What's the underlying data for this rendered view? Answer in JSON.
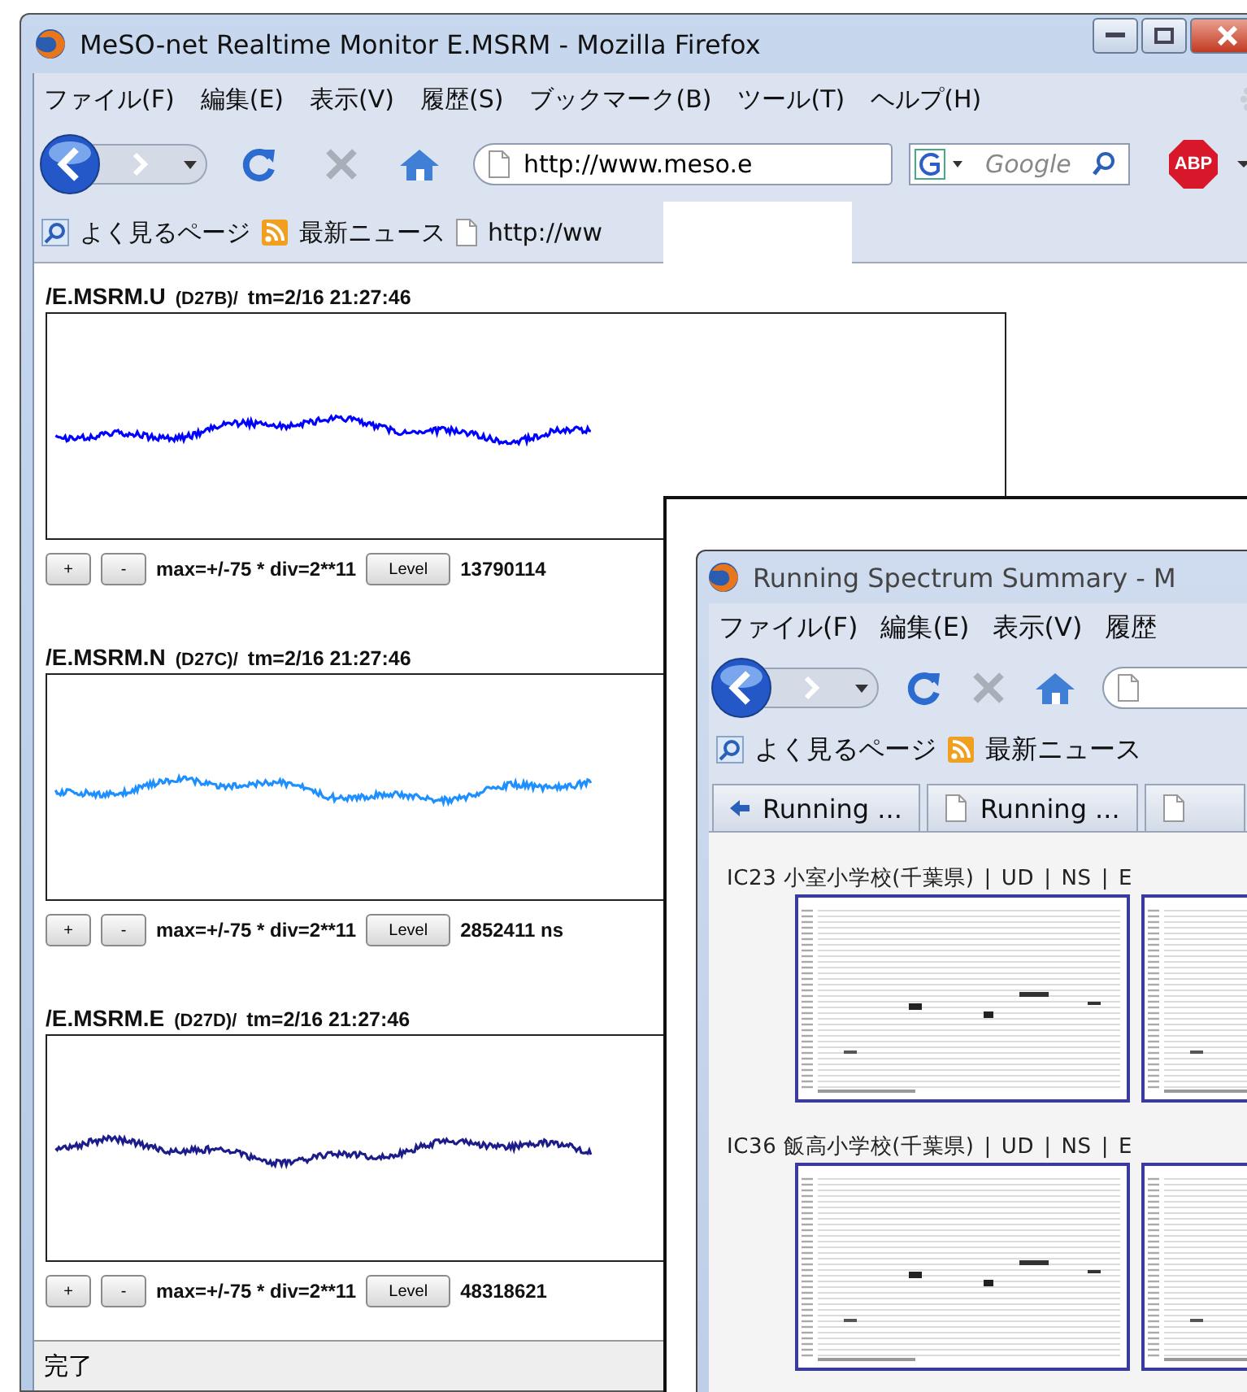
{
  "window": {
    "title": "MeSO-net Realtime Monitor E.MSRM - Mozilla Firefox"
  },
  "menu": [
    "ファイル(F)",
    "編集(E)",
    "表示(V)",
    "履歴(S)",
    "ブックマーク(B)",
    "ツール(T)",
    "ヘルプ(H)"
  ],
  "toolbar": {
    "url": "http://www.meso.e",
    "search": {
      "placeholder": "Google"
    },
    "addon_label": "ABP"
  },
  "bookmarks": [
    "よく見るページ",
    "最新ニュース",
    "http://ww"
  ],
  "channels": [
    {
      "name": "/E.MSRM.U",
      "code": "(D27B)/",
      "time": "tm=2/16 21:27:46",
      "color": "#0000ff",
      "buttons": [
        "+",
        "-"
      ],
      "scale": "max=+/-75 * div=2**11",
      "level_button": "Level",
      "reading": "13790114"
    },
    {
      "name": "/E.MSRM.N",
      "code": "(D27C)/",
      "time": "tm=2/16 21:27:46",
      "color": "#1e8fff",
      "buttons": [
        "+",
        "-"
      ],
      "scale": "max=+/-75 * div=2**11",
      "level_button": "Level",
      "reading": "2852411 ns"
    },
    {
      "name": "/E.MSRM.E",
      "code": "(D27D)/",
      "time": "tm=2/16 21:27:46",
      "color": "#1c1c8a",
      "buttons": [
        "+",
        "-"
      ],
      "scale": "max=+/-75 * div=2**11",
      "level_button": "Level",
      "reading": "48318621"
    }
  ],
  "status_bar": "完了",
  "inset_window": {
    "title": "Running Spectrum Summary - M",
    "menu": [
      "ファイル(F)",
      "編集(E)",
      "表示(V)",
      "履歴"
    ],
    "bookmarks": [
      "よく見るページ",
      "最新ニュース"
    ],
    "tabs": [
      {
        "label": "Running ...",
        "kind": "back"
      },
      {
        "label": "Running ...",
        "kind": "page"
      }
    ],
    "stations": [
      {
        "name": "IC23 小室小学校(千葉県)",
        "separator": "|",
        "links": [
          "UD",
          "NS",
          "E"
        ],
        "thumbnails": [
          {
            "kind": "picture"
          },
          {
            "kind": "picture"
          }
        ]
      },
      {
        "name": "IC36 飯高小学校(千葉県)",
        "separator": "|",
        "links": [
          "UD",
          "NS",
          "E"
        ],
        "thumbnails": [
          {
            "kind": "picture"
          },
          {
            "kind": "picture"
          }
        ]
      }
    ]
  }
}
